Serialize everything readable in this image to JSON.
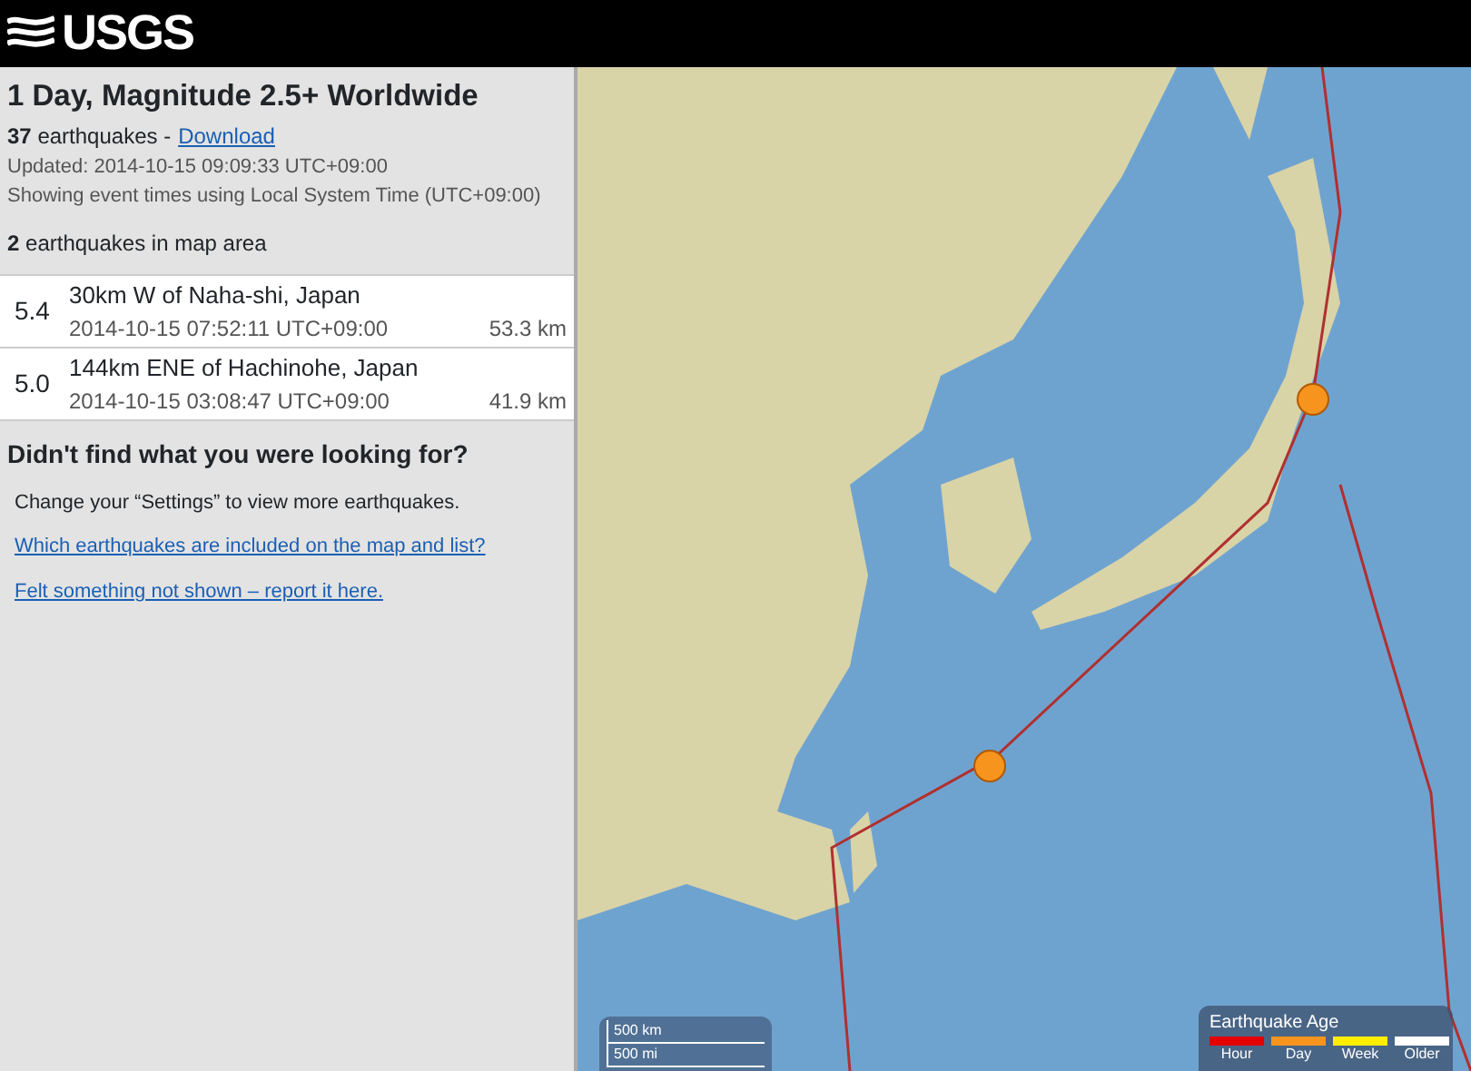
{
  "header": {
    "logo": "USGS"
  },
  "summary": {
    "title": "1 Day, Magnitude 2.5+ Worldwide",
    "count": "37",
    "count_label": "earthquakes -",
    "download": "Download",
    "updated": "Updated: 2014-10-15 09:09:33 UTC+09:00",
    "time_note": "Showing event times using Local System Time (UTC+09:00)",
    "map_count": "2",
    "map_count_label": "earthquakes in map area"
  },
  "earthquakes": [
    {
      "magnitude": "5.4",
      "place": "30km W of Naha-shi, Japan",
      "time": "2014-10-15 07:52:11 UTC+09:00",
      "depth": "53.3 km",
      "color": "#f7941d"
    },
    {
      "magnitude": "5.0",
      "place": "144km ENE of Hachinohe, Japan",
      "time": "2014-10-15 03:08:47 UTC+09:00",
      "depth": "41.9 km",
      "color": "#f7941d"
    }
  ],
  "help": {
    "heading": "Didn't find what you were looking for?",
    "text": "Change your “Settings” to view more earthquakes.",
    "links": [
      "Which earthquakes are included on the map and list?",
      "Felt something not shown – report it here."
    ]
  },
  "map": {
    "scale": [
      "500 km",
      "500 mi"
    ],
    "legend": {
      "title": "Earthquake Age",
      "items": [
        {
          "label": "Hour",
          "color": "#e50000"
        },
        {
          "label": "Day",
          "color": "#f7941d"
        },
        {
          "label": "Week",
          "color": "#ffee00"
        },
        {
          "label": "Older",
          "color": "#ffffff"
        }
      ]
    }
  }
}
